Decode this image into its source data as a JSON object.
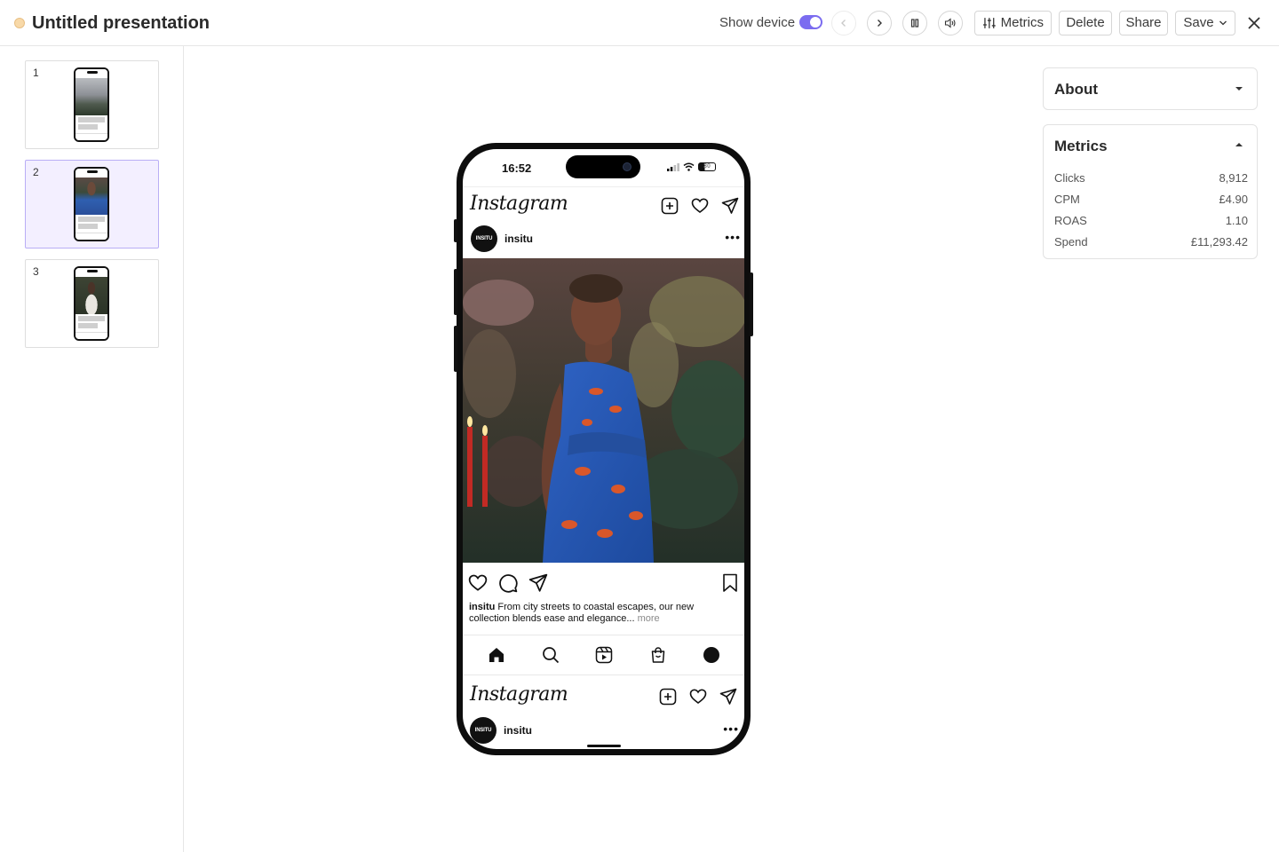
{
  "header": {
    "title": "Untitled presentation",
    "show_device_label": "Show device",
    "show_device_on": true,
    "metrics_label": "Metrics",
    "delete_label": "Delete",
    "share_label": "Share",
    "save_label": "Save"
  },
  "slides": [
    {
      "number": "1",
      "active": false
    },
    {
      "number": "2",
      "active": true
    },
    {
      "number": "3",
      "active": false
    }
  ],
  "phone": {
    "time": "16:52",
    "battery": "30",
    "app_logo": "Instagram",
    "post": {
      "username": "insitu",
      "avatar_text": "INSITU",
      "caption_user": "insitu",
      "caption_text": " From city streets to coastal escapes, our new collection blends ease and elegance...",
      "caption_more": " more"
    },
    "next_post": {
      "username": "insitu",
      "avatar_text": "INSITU"
    }
  },
  "about": {
    "title": "About"
  },
  "metrics": {
    "title": "Metrics",
    "rows": [
      {
        "label": "Clicks",
        "value": "8,912"
      },
      {
        "label": "CPM",
        "value": "£4.90"
      },
      {
        "label": "ROAS",
        "value": "1.10"
      },
      {
        "label": "Spend",
        "value": "£11,293.42"
      }
    ]
  },
  "colors": {
    "accent": "#7b6cf0",
    "status_dot": "#f8d9a8",
    "active_slide_bg": "#f3efff"
  }
}
